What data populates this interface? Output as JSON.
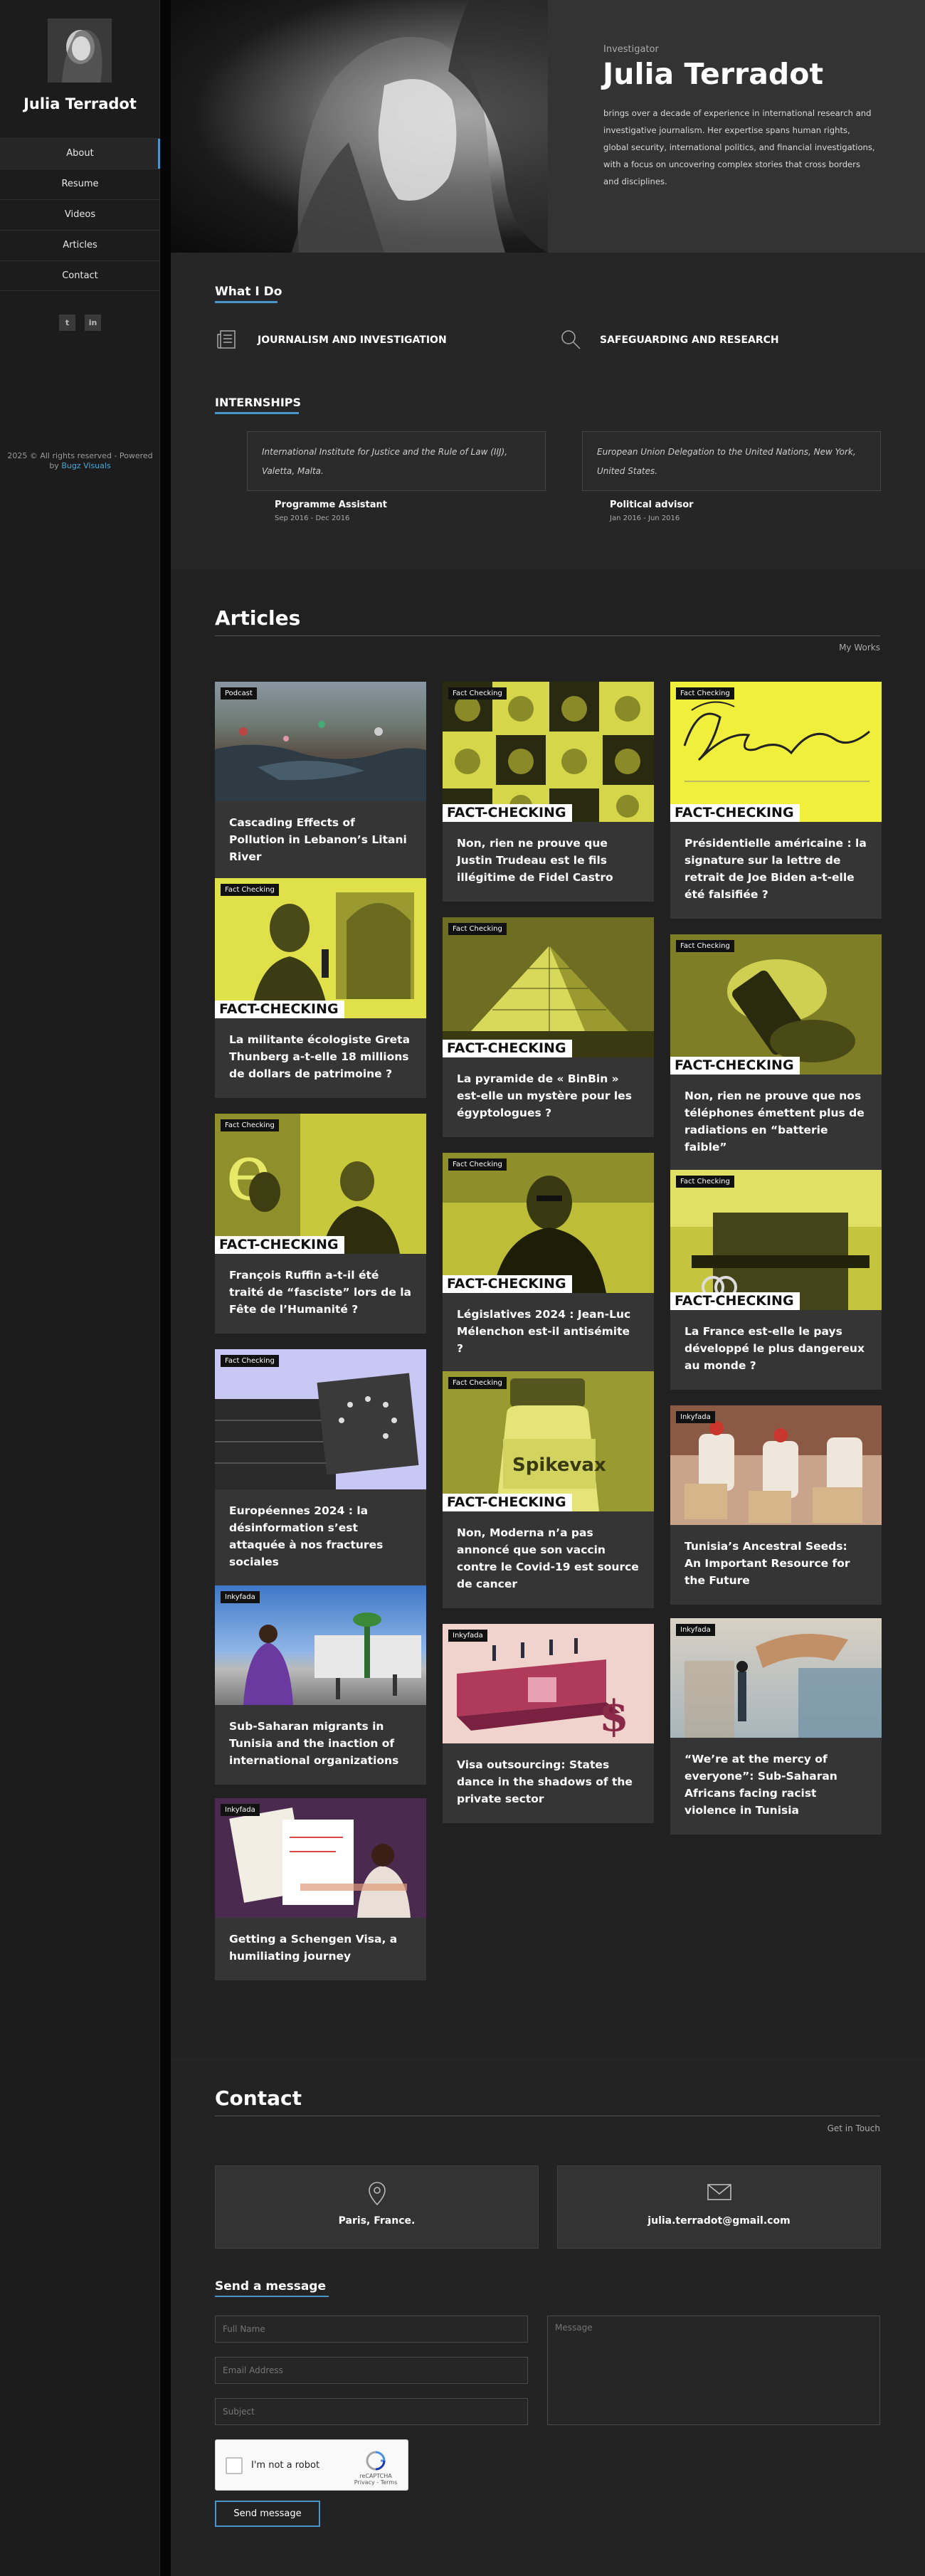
{
  "sidebar": {
    "name": "Julia Terradot",
    "nav": [
      "About",
      "Resume",
      "Videos",
      "Articles",
      "Contact"
    ],
    "social": [
      {
        "icon": "twitter-icon",
        "glyph": "t"
      },
      {
        "icon": "linkedin-icon",
        "glyph": "in"
      }
    ],
    "copyright": "2025 © All rights reserved - Powered by",
    "powered_link": "Bugz Visuals"
  },
  "hero": {
    "role": "Investigator",
    "name": "Julia Terradot",
    "bio": "brings over a decade of experience in international research and investigative journalism. Her expertise spans human rights, global security, international politics, and financial investigations, with a focus on uncovering complex stories that cross borders and disciplines."
  },
  "what_i_do": {
    "title": "What I Do",
    "services": [
      {
        "label": "JOURNALISM AND INVESTIGATION",
        "icon": "newspaper-icon"
      },
      {
        "label": "SAFEGUARDING AND RESEARCH",
        "icon": "search-icon"
      }
    ]
  },
  "internships": {
    "title": "INTERNSHIPS",
    "items": [
      {
        "org": "International Institute for Justice and the Rule of Law (IIJ), Valetta, Malta.",
        "role": "Programme Assistant",
        "dates": "Sep 2016 - Dec 2016"
      },
      {
        "org": "European Union Delegation to the United Nations, New York, United States.",
        "role": "Political advisor",
        "dates": "Jan 2016 - Jun 2016"
      }
    ]
  },
  "articles": {
    "title": "Articles",
    "tagline": "My Works",
    "fact_band": "FACT-CHECKING",
    "items": [
      {
        "badge": "Podcast",
        "title": "Cascading Effects of Pollution in Lebanon’s Litani River"
      },
      {
        "badge": "Fact Checking",
        "title": "La militante écologiste Greta Thunberg a-t-elle 18 millions de dollars de patrimoine ?"
      },
      {
        "badge": "Fact Checking",
        "title": "François Ruffin a-t-il été traité de “fasciste” lors de la Fête de l’Humanité ?"
      },
      {
        "badge": "Fact Checking",
        "title": "Européennes 2024 : la désinformation s’est attaquée à nos fractures sociales"
      },
      {
        "badge": "Inkyfada",
        "title": "Sub-Saharan migrants in Tunisia and the inaction of international organizations"
      },
      {
        "badge": "Inkyfada",
        "title": "Getting a Schengen Visa, a humiliating journey"
      },
      {
        "badge": "Fact Checking",
        "title": "Non, rien ne prouve que Justin Trudeau est le fils illégitime de Fidel Castro"
      },
      {
        "badge": "Fact Checking",
        "title": "La pyramide de « BinBin » est-elle un mystère pour les égyptologues ?"
      },
      {
        "badge": "Fact Checking",
        "title": "Législatives 2024 : Jean-Luc Mélenchon est-il antisémite ?"
      },
      {
        "badge": "Fact Checking",
        "title": "Non, Moderna n’a pas annoncé que son vaccin contre le Covid-19 est source de cancer"
      },
      {
        "badge": "Inkyfada",
        "title": "Visa outsourcing: States dance in the shadows of the private sector"
      },
      {
        "badge": "Fact Checking",
        "title": "Présidentielle américaine : la signature sur la lettre de retrait de Joe Biden a-t-elle été falsifiée ?"
      },
      {
        "badge": "Fact Checking",
        "title": "Non, rien ne prouve que nos téléphones émettent plus de radiations en “batterie faible”"
      },
      {
        "badge": "Fact Checking",
        "title": "La France est-elle le pays développé le plus dangereux au monde ?"
      },
      {
        "badge": "Inkyfada",
        "title": "Tunisia’s Ancestral Seeds: An Important Resource for the Future"
      },
      {
        "badge": "Inkyfada",
        "title": "“We’re at the mercy of everyone”: Sub-Saharan Africans facing racist violence in Tunisia"
      }
    ]
  },
  "contact": {
    "title": "Contact",
    "tagline": "Get in Touch",
    "location": "Paris, France.",
    "email": "julia.terradot@gmail.com",
    "form_title": "Send a message",
    "placeholders": {
      "name": "Full Name",
      "email": "Email Address",
      "subject": "Subject",
      "message": "Message"
    },
    "captcha_label": "I'm not a robot",
    "captcha_brand": "reCAPTCHA",
    "captcha_links": "Privacy - Terms",
    "send": "Send message"
  },
  "colors": {
    "accent": "#4a95c9",
    "fact_yellow": "#e6e645",
    "bg": "#212121",
    "card": "#353535"
  }
}
